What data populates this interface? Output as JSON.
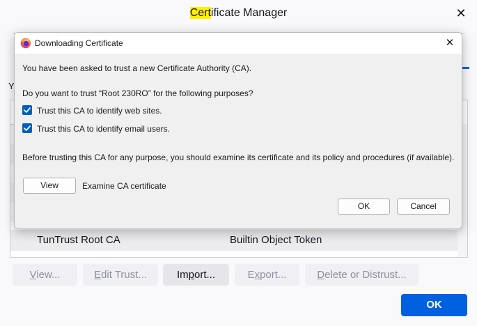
{
  "manager": {
    "title_highlight": "Cert",
    "title_rest": "ificate Manager",
    "close_glyph": "✕",
    "intro_fragment": "Y",
    "visible_row": {
      "name": "TunTrust Root CA",
      "token": "Builtin Object Token"
    },
    "buttons": {
      "view_u": "V",
      "view_rest": "iew...",
      "edit_u": "E",
      "edit_rest": "dit Trust...",
      "import_pre": "Im",
      "import_u": "p",
      "import_rest": "ort...",
      "export_pre": "E",
      "export_u": "x",
      "export_rest": "port...",
      "delete_u": "D",
      "delete_rest": "elete or Distrust..."
    },
    "ok_label": "OK"
  },
  "dialog": {
    "title": "Downloading Certificate",
    "close_glyph": "✕",
    "intro": "You have been asked to trust a new Certificate Authority (CA).",
    "question": "Do you want to trust “Root 230RO” for the following purposes?",
    "checks": [
      {
        "label": "Trust this CA to identify web sites.",
        "checked": true
      },
      {
        "label": "Trust this CA to identify email users.",
        "checked": true
      }
    ],
    "advice": "Before trusting this CA for any purpose, you should examine its certificate and its policy and procedures (if available).",
    "view_label": "View",
    "examine_label": "Examine CA certificate",
    "ok_label": "OK",
    "cancel_label": "Cancel"
  },
  "colors": {
    "accent": "#0061e0",
    "highlight": "#ffef00",
    "checkbox": "#0060c0"
  },
  "icons": {
    "firefox": "firefox-icon",
    "close": "close-icon",
    "check": "check-icon"
  }
}
